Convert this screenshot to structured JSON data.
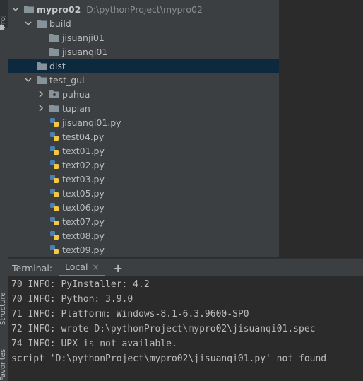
{
  "left_strip": {
    "tabs": [
      "Proj",
      "Structure",
      "Favorites"
    ]
  },
  "project_tree": {
    "rows": [
      {
        "name": "mypro02",
        "path": "D:\\pythonProject\\mypro02",
        "type": "folder",
        "expanded": true
      },
      {
        "name": "build",
        "type": "folder",
        "expanded": true
      },
      {
        "name": "jisuanji01",
        "type": "folder"
      },
      {
        "name": "jisuanqi01",
        "type": "folder"
      },
      {
        "name": "dist",
        "type": "folder",
        "selected": true
      },
      {
        "name": "test_gui",
        "type": "folder",
        "expanded": true
      },
      {
        "name": "puhua",
        "type": "folder",
        "collapsed": true
      },
      {
        "name": "tupian",
        "type": "folder",
        "collapsed": true
      },
      {
        "name": "jisuanqi01.py",
        "type": "python"
      },
      {
        "name": "test04.py",
        "type": "python"
      },
      {
        "name": "text01.py",
        "type": "python"
      },
      {
        "name": "text02.py",
        "type": "python"
      },
      {
        "name": "text03.py",
        "type": "python"
      },
      {
        "name": "text05.py",
        "type": "python"
      },
      {
        "name": "text06.py",
        "type": "python"
      },
      {
        "name": "text07.py",
        "type": "python"
      },
      {
        "name": "text08.py",
        "type": "python"
      },
      {
        "name": "text09.py",
        "type": "python"
      }
    ]
  },
  "terminal": {
    "title": "Terminal:",
    "tab_label": "Local",
    "close_glyph": "×",
    "add_glyph": "+",
    "lines": [
      "70 INFO: PyInstaller: 4.2",
      "70 INFO: Python: 3.9.0",
      "71 INFO: Platform: Windows-8.1-6.3.9600-SP0",
      "72 INFO: wrote D:\\pythonProject\\mypro02\\jisuanqi01.spec",
      "74 INFO: UPX is not available.",
      "script 'D:\\pythonProject\\mypro02\\jisuanqi01.py' not found"
    ]
  },
  "colors": {
    "panel_bg": "#3c3f41",
    "editor_bg": "#2b2b2b",
    "selection": "#0d293e",
    "folder": "#87939a",
    "python_blue": "#4b7fb8",
    "python_yellow": "#f5c842"
  }
}
